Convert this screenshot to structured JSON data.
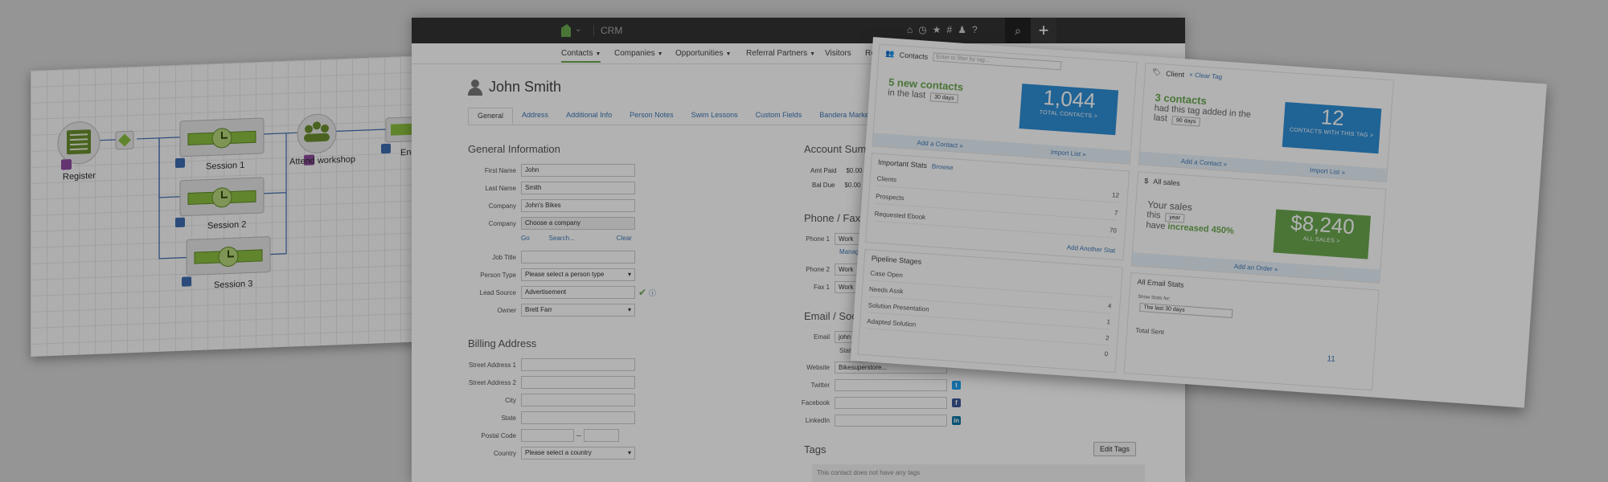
{
  "workflow": {
    "nodes": [
      {
        "label": "Register"
      },
      {
        "label": "Session 1"
      },
      {
        "label": "Session 2"
      },
      {
        "label": "Session 3"
      },
      {
        "label": "Attend workshop"
      },
      {
        "label": "En"
      }
    ]
  },
  "crm": {
    "app_name": "CRM",
    "nav": [
      "Contacts",
      "Companies",
      "Opportunities",
      "Referral Partners",
      "Visitors",
      "Re"
    ],
    "contact_name": "John Smith",
    "tabs": [
      "General",
      "Address",
      "Additional Info",
      "Person Notes",
      "Swim Lessons",
      "Custom Fields",
      "Bandera Marke"
    ],
    "general_title": "General Information",
    "fields": [
      {
        "label": "First Name",
        "value": "John"
      },
      {
        "label": "Last Name",
        "value": "Smith"
      },
      {
        "label": "Company",
        "value": "John's Bikes"
      },
      {
        "label": "Company",
        "value": "Choose a company"
      }
    ],
    "company_links": [
      "Go",
      "Search...",
      "Clear"
    ],
    "fields2": [
      {
        "label": "Job Title",
        "value": ""
      },
      {
        "label": "Person Type",
        "value": "Please select a person type"
      },
      {
        "label": "Lead Source",
        "value": "Advertisement"
      },
      {
        "label": "Owner",
        "value": "Brett Farr"
      }
    ],
    "billing_title": "Billing Address",
    "billing": [
      {
        "label": "Street Address 1",
        "value": ""
      },
      {
        "label": "Street Address 2",
        "value": ""
      },
      {
        "label": "City",
        "value": ""
      },
      {
        "label": "State",
        "value": ""
      },
      {
        "label": "Postal Code",
        "value": ""
      },
      {
        "label": "Country",
        "value": "Please select a country"
      }
    ],
    "account_title": "Account Sum",
    "account": [
      {
        "label": "Amt Paid",
        "value": "$0.00"
      },
      {
        "label": "Bal Due",
        "value": "$0.00"
      }
    ],
    "phone_title": "Phone / Fax",
    "phones": [
      {
        "label": "Phone 1",
        "value": "Work"
      },
      {
        "label": "Phone 2",
        "value": "Work"
      },
      {
        "label": "Fax 1",
        "value": "Work"
      }
    ],
    "manage_link": "Manag",
    "email_title": "Email / Soc",
    "email": {
      "label": "Email",
      "value": "john",
      "status": "Statu"
    },
    "web": [
      {
        "label": "Website",
        "value": "Bikesuperstore..."
      },
      {
        "label": "Twitter",
        "value": ""
      },
      {
        "label": "Facebook",
        "value": ""
      },
      {
        "label": "LinkedIn",
        "value": ""
      }
    ],
    "tags_title": "Tags",
    "edit_tags": "Edit Tags",
    "tags_note": "This contact does not have any tags"
  },
  "dashboard": {
    "contacts_panel": {
      "title": "Contacts",
      "filter_placeholder": "Enter to filter by tag...",
      "headline": "5 new contacts",
      "in_the_last": "in the last",
      "range": "30 days",
      "count": "1,044",
      "count_caption": "TOTAL CONTACTS >",
      "foot": [
        "Add a Contact »",
        "Import List »"
      ]
    },
    "client_panel": {
      "title": "Client",
      "tag_link": "× Clear Tag",
      "headline": "3 contacts",
      "line2": "had this tag added in the",
      "last": "last",
      "range": "90 days",
      "count": "12",
      "count_caption": "CONTACTS WITH THIS TAG >",
      "foot": [
        "Add a Contact »",
        "Import List »"
      ]
    },
    "important_stats": {
      "title": "Important Stats",
      "link": "Browse",
      "rows": [
        {
          "label": "Clients",
          "value": "12"
        },
        {
          "label": "Prospects",
          "value": "7"
        },
        {
          "label": "Requested Ebook",
          "value": "70"
        }
      ],
      "add": "Add Another Stat"
    },
    "sales": {
      "title": "All sales",
      "line1": "Your sales",
      "this": "this",
      "range": "year",
      "have": "have",
      "increased": "increased 450%",
      "amount": "$8,240",
      "caption": "ALL SALES >",
      "foot": "Add an Order »"
    },
    "pipeline": {
      "title": "Pipeline Stages",
      "rows": [
        {
          "label": "Case Open",
          "value": ""
        },
        {
          "label": "Needs Assk",
          "value": "4"
        },
        {
          "label": "Solution Presentation",
          "value": "1"
        },
        {
          "label": "Adapted Solution",
          "value": "2"
        },
        {
          "label": "",
          "value": "0"
        }
      ]
    },
    "email_stats": {
      "title": "All Email Stats",
      "sub": "Show Stats for:",
      "range": "The last 30 days",
      "total_label": "Total Sent",
      "total_value": "11"
    }
  },
  "colors": {
    "accent_green": "#6aa84f",
    "stat_blue": "#2e8fd6",
    "topbar": "#333333",
    "link_blue": "#3d77b6"
  }
}
